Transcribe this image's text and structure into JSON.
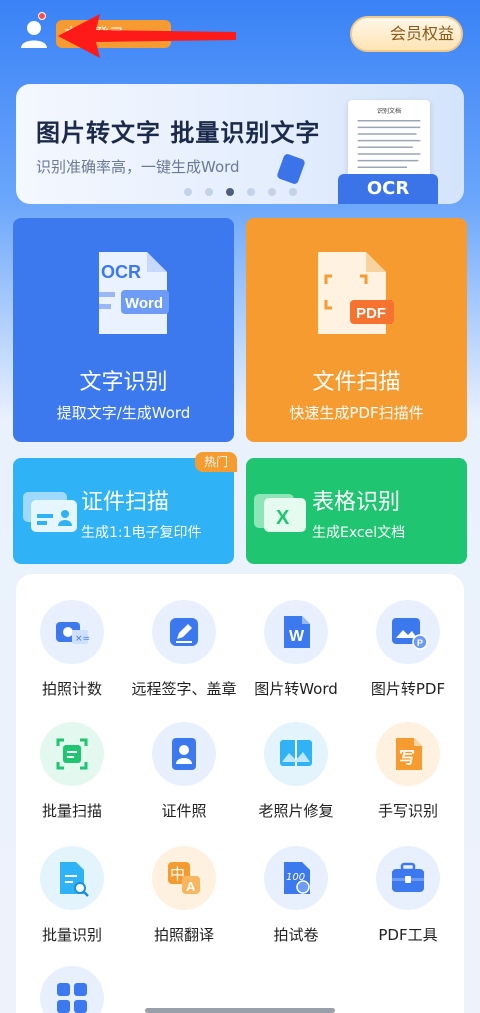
{
  "header": {
    "login_text": "立即登录",
    "vip_label": "会员权益",
    "colors": {
      "login_tag": "#f59b32",
      "arrow": "#ff1a1a"
    }
  },
  "banner": {
    "title": "图片转文字 批量识别文字",
    "subtitle": "识别准确率高，一键生成Word",
    "badge": "OCR",
    "doc_title": "识别文档",
    "dots": 6,
    "active_dot": 3
  },
  "cards": {
    "ocr": {
      "title": "文字识别",
      "subtitle": "提取文字/生成Word",
      "icon_top": "OCR",
      "icon_tag": "Word",
      "color": "#3c79ee"
    },
    "scan": {
      "title": "文件扫描",
      "subtitle": "快速生成PDF扫描件",
      "icon_tag": "PDF",
      "color": "#f59b2f"
    },
    "id_scan": {
      "title": "证件扫描",
      "subtitle": "生成1:1电子复印件",
      "badge": "热门",
      "color": "#2fb2f6"
    },
    "table": {
      "title": "表格识别",
      "subtitle": "生成Excel文档",
      "icon_tag": "X",
      "color": "#1fc570"
    }
  },
  "tools": [
    {
      "label": "拍照计数",
      "icon": "camera-count-icon"
    },
    {
      "label": "远程签字、盖章",
      "icon": "pen-sign-icon"
    },
    {
      "label": "图片转Word",
      "icon": "word-doc-icon",
      "glyph": "W"
    },
    {
      "label": "图片转PDF",
      "icon": "image-pdf-icon"
    },
    {
      "label": "批量扫描",
      "icon": "batch-scan-icon"
    },
    {
      "label": "证件照",
      "icon": "id-photo-icon"
    },
    {
      "label": "老照片修复",
      "icon": "photo-restore-icon"
    },
    {
      "label": "手写识别",
      "icon": "handwriting-icon",
      "glyph": "写"
    },
    {
      "label": "批量识别",
      "icon": "batch-recognize-icon"
    },
    {
      "label": "拍照翻译",
      "icon": "translate-icon",
      "glyph": "中"
    },
    {
      "label": "拍试卷",
      "icon": "exam-paper-icon",
      "glyph": "100"
    },
    {
      "label": "PDF工具",
      "icon": "briefcase-icon"
    },
    {
      "label": "",
      "icon": "grid-apps-icon"
    }
  ]
}
